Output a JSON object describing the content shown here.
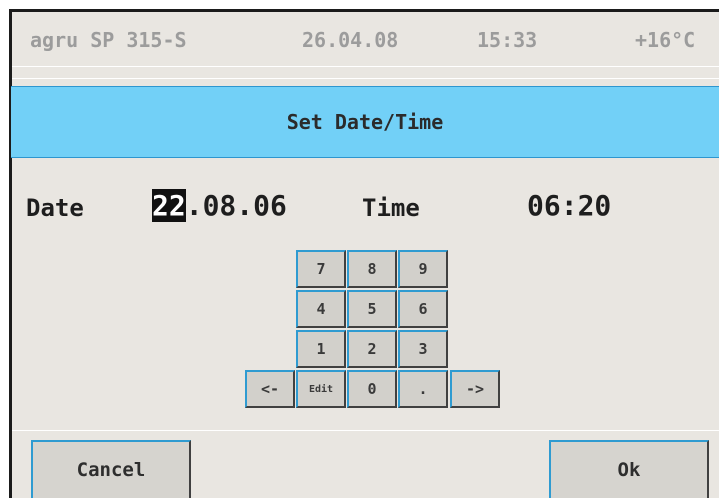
{
  "status": {
    "device": "agru SP 315-S",
    "date": "26.04.08",
    "time": "15:33",
    "temperature": "+16°C"
  },
  "dialog": {
    "title": "Set Date/Time"
  },
  "fields": {
    "date_label": "Date",
    "date_value_selected": "22",
    "date_value_rest": ".08.06",
    "time_label": "Time",
    "time_value": "06:20"
  },
  "keypad": {
    "k7": "7",
    "k8": "8",
    "k9": "9",
    "k4": "4",
    "k5": "5",
    "k6": "6",
    "k1": "1",
    "k2": "2",
    "k3": "3",
    "left": "<-",
    "edit": "Edit",
    "k0": "0",
    "dot": ".",
    "right": "->"
  },
  "buttons": {
    "cancel": "Cancel",
    "ok": "Ok"
  },
  "colors": {
    "title_bar": "#72d0f7",
    "accent_border": "#2f9bd1",
    "background": "#e9e6e1"
  }
}
